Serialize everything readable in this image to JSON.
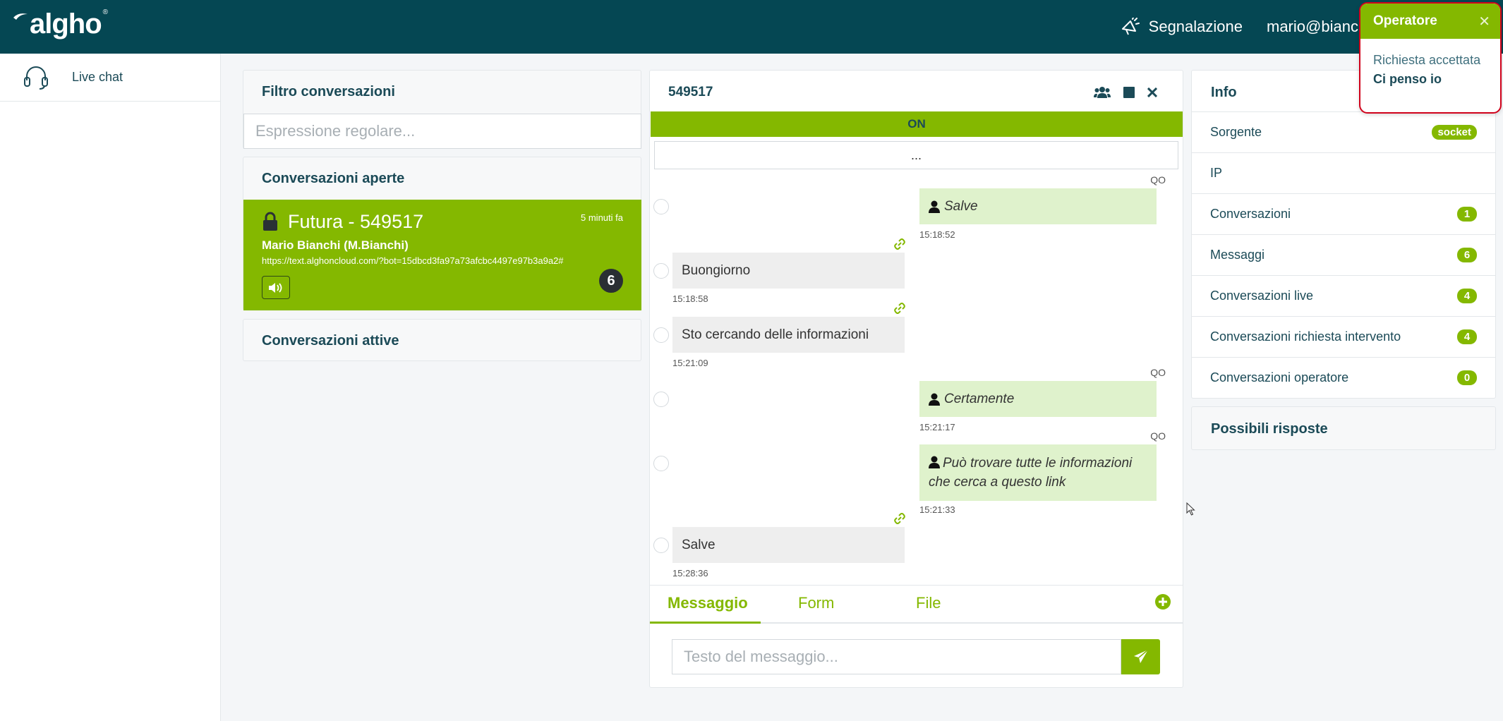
{
  "app": {
    "logo": "algho",
    "logo_mark": "®"
  },
  "header": {
    "report_label": "Segnalazione",
    "user_email": "mario@bianchi.it"
  },
  "sidebar": {
    "items": [
      {
        "label": "Live chat",
        "icon": "headset-icon"
      }
    ]
  },
  "filter": {
    "title": "Filtro conversazioni",
    "placeholder": "Espressione regolare..."
  },
  "open_conversations": {
    "title": "Conversazioni aperte",
    "items": [
      {
        "title": "Futura  - 549517",
        "time": "5 minuti fa",
        "user": "Mario Bianchi (M.Bianchi)",
        "url": "https://text.alghoncloud.com/?bot=15dbcd3fa97a73afcbc4497e97b3a9a2#",
        "count": "6"
      }
    ]
  },
  "active_conversations": {
    "title": "Conversazioni attive"
  },
  "chat": {
    "id": "549517",
    "status": "ON",
    "more_label": "...",
    "messages": [
      {
        "from": "bot",
        "sender": "QO",
        "text": "Salve",
        "time": "15:18:52"
      },
      {
        "from": "user",
        "text": "Buongiorno",
        "time": "15:18:58"
      },
      {
        "from": "user",
        "text": "Sto cercando delle informazioni",
        "time": "15:21:09"
      },
      {
        "from": "bot",
        "sender": "QO",
        "text": "Certamente",
        "time": "15:21:17"
      },
      {
        "from": "bot",
        "sender": "QO",
        "text_line1": "Può trovare tutte le informazioni",
        "text_line2": "che cerca a questo link",
        "time": "15:21:33"
      },
      {
        "from": "user",
        "text": "Salve",
        "time": "15:28:36"
      }
    ],
    "tabs": [
      "Messaggio",
      "Form",
      "File"
    ],
    "input_placeholder": "Testo del messaggio..."
  },
  "info": {
    "title": "Info",
    "rows": [
      {
        "label": "Sorgente",
        "badge": "socket"
      },
      {
        "label": "IP",
        "badge": ""
      },
      {
        "label": "Conversazioni",
        "badge": "1"
      },
      {
        "label": "Messaggi",
        "badge": "6"
      },
      {
        "label": "Conversazioni live",
        "badge": "4"
      },
      {
        "label": "Conversazioni richiesta intervento",
        "badge": "4"
      },
      {
        "label": "Conversazioni operatore",
        "badge": "0"
      }
    ]
  },
  "possible_answers": {
    "title": "Possibili risposte"
  },
  "toast": {
    "title": "Operatore",
    "message": "Richiesta accettata",
    "action": "Ci penso io"
  },
  "colors": {
    "brand_dark": "#054753",
    "accent_green": "#84b800",
    "text": "#1b4a57",
    "alert_red": "#d0021b"
  }
}
